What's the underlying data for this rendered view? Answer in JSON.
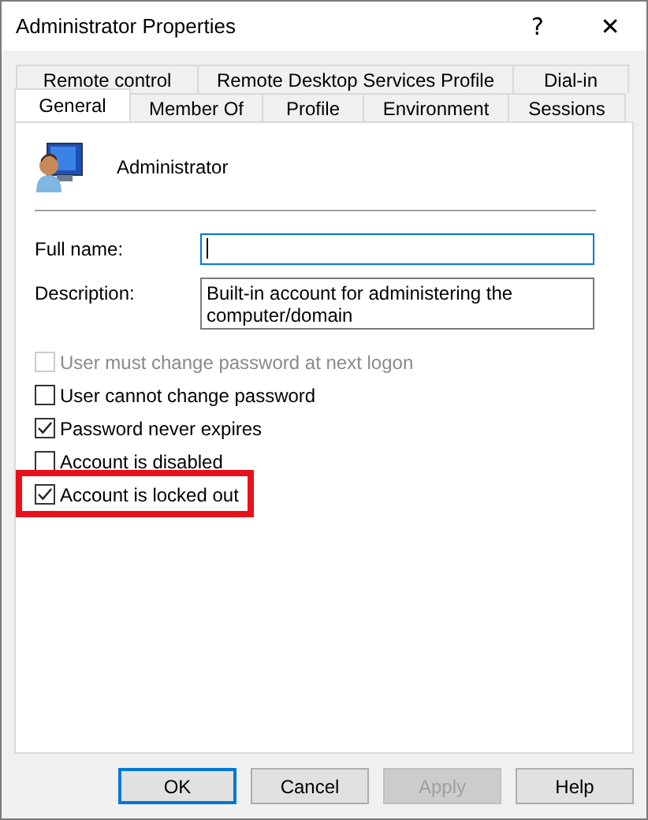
{
  "window": {
    "title": "Administrator Properties",
    "title_buttons": [
      "?",
      "✕"
    ]
  },
  "tab_rows": [
    [
      {
        "label": "Remote control",
        "selected": false
      },
      {
        "label": "Remote Desktop Services Profile",
        "selected": false
      },
      {
        "label": "Dial-in",
        "selected": false
      }
    ],
    [
      {
        "label": "General",
        "selected": true
      },
      {
        "label": "Member Of",
        "selected": false
      },
      {
        "label": "Profile",
        "selected": false
      },
      {
        "label": "Environment",
        "selected": false
      },
      {
        "label": "Sessions",
        "selected": false
      }
    ]
  ],
  "user": {
    "name": "Administrator"
  },
  "fields": [
    {
      "label": "Full name:",
      "focused": true
    },
    {
      "label": "Description:",
      "value": "Built-in account for administering the computer/domain",
      "focused": false
    }
  ],
  "checkboxes": [
    {
      "label": "User must change password at next logon",
      "checked": false,
      "disabled": true,
      "highlighted": false
    },
    {
      "label": "User cannot change password",
      "checked": false,
      "disabled": false,
      "highlighted": false
    },
    {
      "label": "Password never expires",
      "checked": true,
      "disabled": false,
      "highlighted": false
    },
    {
      "label": "Account is disabled",
      "checked": false,
      "disabled": false,
      "highlighted": false
    },
    {
      "label": "Account is locked out",
      "checked": true,
      "disabled": false,
      "highlighted": true
    }
  ],
  "buttons": [
    {
      "label": "OK",
      "default": true,
      "disabled": false
    },
    {
      "label": "Cancel",
      "default": false,
      "disabled": false
    },
    {
      "label": "Apply",
      "default": false,
      "disabled": true
    },
    {
      "label": "Help",
      "default": false,
      "disabled": false
    }
  ]
}
